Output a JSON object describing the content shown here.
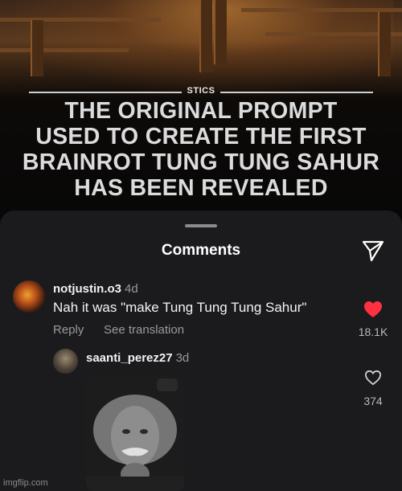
{
  "post": {
    "source": "STICS",
    "headline_lines": [
      "THE ORIGINAL PROMPT",
      "USED TO CREATE THE FIRST",
      "BRAINROT TUNG TUNG SAHUR",
      "HAS BEEN REVEALED"
    ]
  },
  "comments_sheet": {
    "title": "Comments",
    "share_icon": "send-icon"
  },
  "comments": [
    {
      "username": "notjustin.o3",
      "age": "4d",
      "text": "Nah it was \"make Tung Tung Tung Sahur\"",
      "reply_label": "Reply",
      "translate_label": "See translation",
      "likes": "18.1K",
      "liked": true,
      "heart_color": "#ff3040"
    },
    {
      "username": "saanti_perez27",
      "age": "3d",
      "likes": "374",
      "liked": false,
      "attachment": "einstein-photo"
    }
  ],
  "watermark": "imgflip.com"
}
